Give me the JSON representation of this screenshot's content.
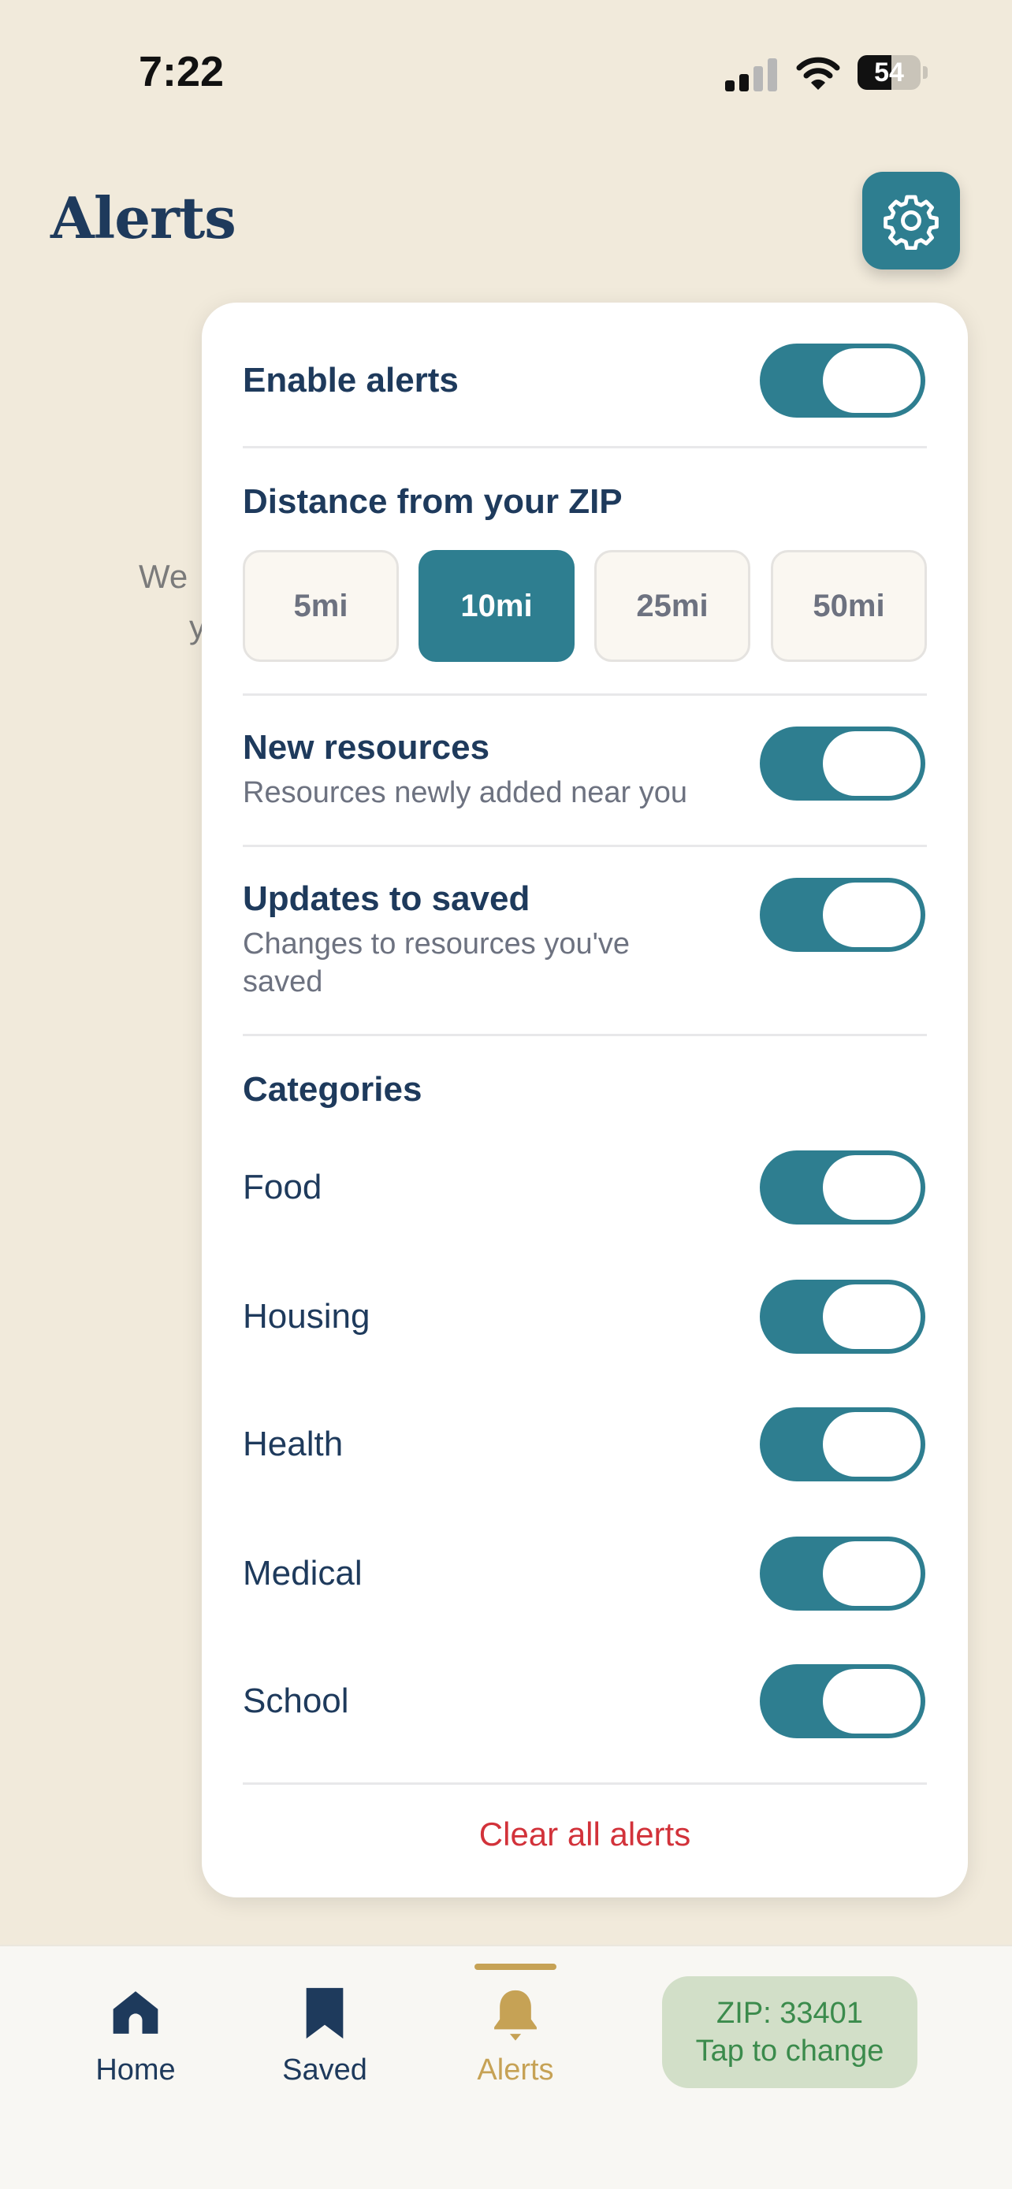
{
  "status_bar": {
    "time": "7:22",
    "battery": "54",
    "battery_level": 0.54
  },
  "header": {
    "title": "Alerts",
    "settings_icon": "gear-icon"
  },
  "background_text": {
    "line1": "We",
    "line2": "y"
  },
  "settings_panel": {
    "enable_alerts": {
      "label": "Enable alerts",
      "on": true
    },
    "distance": {
      "label": "Distance from your ZIP",
      "options": [
        "5mi",
        "10mi",
        "25mi",
        "50mi"
      ],
      "selected": "10mi"
    },
    "new_resources": {
      "label": "New resources",
      "description": "Resources newly added near you",
      "on": true
    },
    "updates_to_saved": {
      "label": "Updates to saved",
      "description": "Changes to resources you've saved",
      "on": true
    },
    "categories": {
      "label": "Categories",
      "items": [
        {
          "label": "Food",
          "on": true
        },
        {
          "label": "Housing",
          "on": true
        },
        {
          "label": "Health",
          "on": true
        },
        {
          "label": "Medical",
          "on": true
        },
        {
          "label": "School",
          "on": true
        }
      ]
    },
    "clear_label": "Clear all alerts"
  },
  "tab_bar": {
    "items": [
      {
        "label": "Home",
        "icon": "home-icon"
      },
      {
        "label": "Saved",
        "icon": "bookmark-icon"
      },
      {
        "label": "Alerts",
        "icon": "bell-icon",
        "active": true
      }
    ],
    "zip": {
      "line1": "ZIP: 33401",
      "line2": "Tap to change"
    }
  },
  "colors": {
    "accent": "#2e7e90",
    "navy": "#1e3a5c",
    "gold": "#c6a255",
    "danger": "#d2323a",
    "background": "#f1eadb"
  }
}
